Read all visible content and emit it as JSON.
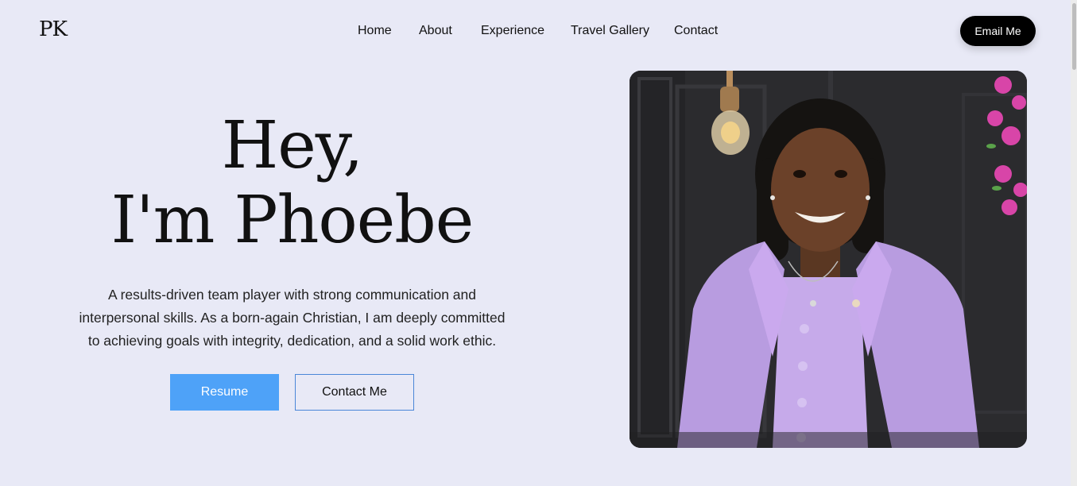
{
  "header": {
    "logo": "PK",
    "nav": [
      {
        "label": "Home"
      },
      {
        "label": "About"
      },
      {
        "label": "Experience"
      },
      {
        "label": "Travel Gallery"
      },
      {
        "label": "Contact"
      }
    ],
    "email_button": "Email Me"
  },
  "hero": {
    "greeting": "Hey,",
    "name_line": "I'm Phoebe",
    "intro_lines": [
      "A results-driven team player with strong communication and",
      "interpersonal skills. As a born-again Christian, I am deeply committed",
      "to achieving goals with integrity, dedication, and a solid work ethic."
    ],
    "resume_button": "Resume",
    "contact_button": "Contact Me"
  },
  "colors": {
    "background": "#e8e9f6",
    "primary_button": "#4ea2f8",
    "dark_button": "#000000",
    "suit": "#c4a6e6"
  }
}
